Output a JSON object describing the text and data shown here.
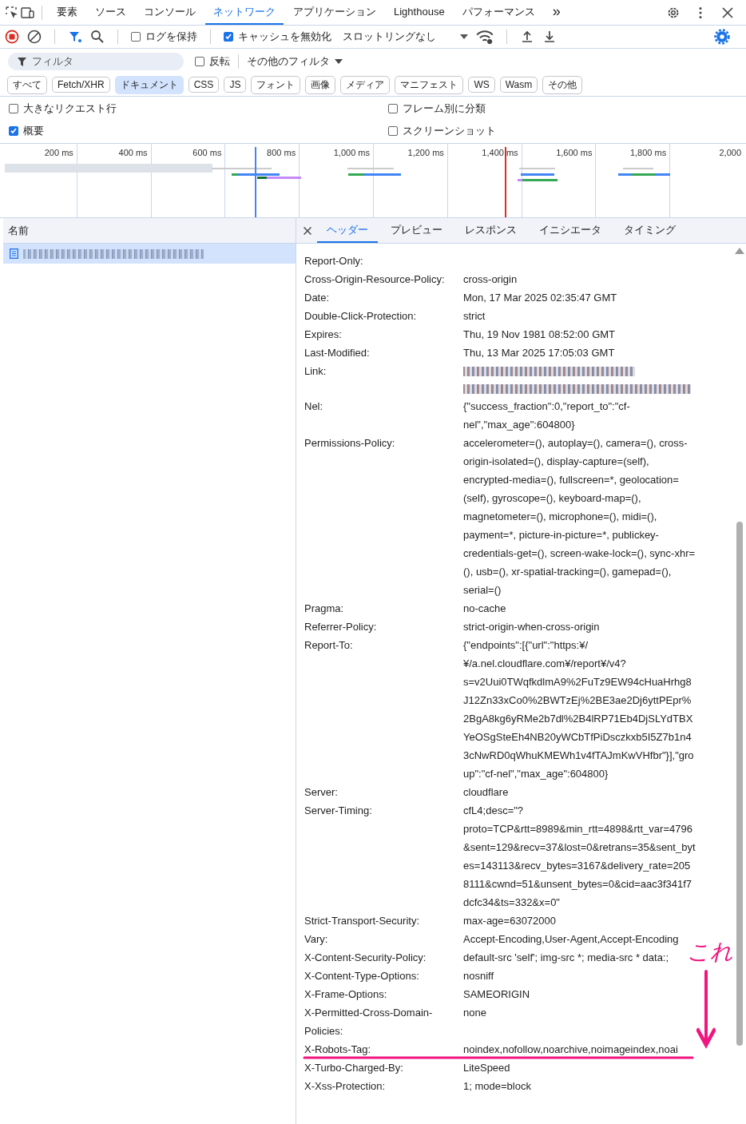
{
  "main_tabs": [
    {
      "label": "要素",
      "selected": false
    },
    {
      "label": "ソース",
      "selected": false
    },
    {
      "label": "コンソール",
      "selected": false
    },
    {
      "label": "ネットワーク",
      "selected": true
    },
    {
      "label": "アプリケーション",
      "selected": false
    },
    {
      "label": "Lighthouse",
      "selected": false
    },
    {
      "label": "パフォーマンス",
      "selected": false
    }
  ],
  "more_tabs": "»",
  "toolbar": {
    "preserve_log": {
      "label": "ログを保持",
      "checked": false
    },
    "disable_cache": {
      "label": "キャッシュを無効化",
      "checked": true
    },
    "throttling": "スロットリングなし"
  },
  "filter": {
    "placeholder": "フィルタ",
    "invert": {
      "label": "反転",
      "checked": false
    },
    "more_filters": "その他のフィルタ"
  },
  "type_filters": [
    {
      "label": "すべて",
      "selected": false
    },
    {
      "label": "Fetch/XHR",
      "selected": false
    },
    {
      "label": "ドキュメント",
      "selected": true
    },
    {
      "label": "CSS",
      "selected": false
    },
    {
      "label": "JS",
      "selected": false
    },
    {
      "label": "フォント",
      "selected": false
    },
    {
      "label": "画像",
      "selected": false
    },
    {
      "label": "メディア",
      "selected": false
    },
    {
      "label": "マニフェスト",
      "selected": false
    },
    {
      "label": "WS",
      "selected": false
    },
    {
      "label": "Wasm",
      "selected": false
    },
    {
      "label": "その他",
      "selected": false
    }
  ],
  "options": [
    {
      "label": "大きなリクエスト行",
      "checked": false
    },
    {
      "label": "フレーム別に分類",
      "checked": false
    },
    {
      "label": "概要",
      "checked": true
    },
    {
      "label": "スクリーンショット",
      "checked": false
    }
  ],
  "timeline": {
    "ticks": [
      "200 ms",
      "400 ms",
      "600 ms",
      "800 ms",
      "1,000 ms",
      "1,200 ms",
      "1,400 ms",
      "1,600 ms",
      "1,800 ms",
      "2,000"
    ]
  },
  "requests": {
    "column": "名前",
    "rows": [
      {
        "selected": true
      }
    ]
  },
  "detail_tabs": [
    {
      "label": "ヘッダー",
      "selected": true
    },
    {
      "label": "プレビュー",
      "selected": false
    },
    {
      "label": "レスポンス",
      "selected": false
    },
    {
      "label": "イニシエータ",
      "selected": false
    },
    {
      "label": "タイミング",
      "selected": false
    }
  ],
  "headers": [
    {
      "name": "Report-Only:"
    },
    {
      "name": "Cross-Origin-Resource-Policy:",
      "value": "cross-origin"
    },
    {
      "name": "Date:",
      "value": "Mon, 17 Mar 2025 02:35:47 GMT"
    },
    {
      "name": "Double-Click-Protection:",
      "value": "strict"
    },
    {
      "name": "Expires:",
      "value": "Thu, 19 Nov 1981 08:52:00 GMT"
    },
    {
      "name": "Last-Modified:",
      "value": "Thu, 13 Mar 2025 17:05:03 GMT"
    },
    {
      "name": "Link:",
      "redacted": true
    },
    {
      "name": "Nel:",
      "value": "{\"success_fraction\":0,\"report_to\":\"cf-nel\",\"max_age\":604800}"
    },
    {
      "name": "Permissions-Policy:",
      "value": "accelerometer=(), autoplay=(), camera=(), cross-origin-isolated=(), display-capture=(self), encrypted-media=(), fullscreen=*, geolocation=(self), gyroscope=(), keyboard-map=(), magnetometer=(), microphone=(), midi=(), payment=*, picture-in-picture=*, publickey-credentials-get=(), screen-wake-lock=(), sync-xhr=(), usb=(), xr-spatial-tracking=(), gamepad=(), serial=()"
    },
    {
      "name": "Pragma:",
      "value": "no-cache"
    },
    {
      "name": "Referrer-Policy:",
      "value": "strict-origin-when-cross-origin"
    },
    {
      "name": "Report-To:",
      "value": "{\"endpoints\":[{\"url\":\"https:¥/¥/a.nel.cloudflare.com¥/report¥/v4?s=v2Uui0TWqfkdlmA9%2FuTz9EW94cHuaHrhg8J12Zn33xCo0%2BWTzEj%2BE3ae2Dj6yttPEpr%2BgA8kg6yRMe2b7dl%2B4lRP71Eb4DjSLYdTBXYeOSgSteEh4NB20yWCbTfPiDsczkxb5I5Z7b1n43cNwRD0qWhuKMEWh1v4fTAJmKwVHfbr\"}],\"group\":\"cf-nel\",\"max_age\":604800}"
    },
    {
      "name": "Server:",
      "value": "cloudflare"
    },
    {
      "name": "Server-Timing:",
      "value": "cfL4;desc=\"?proto=TCP&rtt=8989&min_rtt=4898&rtt_var=4796&sent=129&recv=37&lost=0&retrans=35&sent_bytes=143113&recv_bytes=3167&delivery_rate=2058111&cwnd=51&unsent_bytes=0&cid=aac3f341f7dcfc34&ts=332&x=0\""
    },
    {
      "name": "Strict-Transport-Security:",
      "value": "max-age=63072000"
    },
    {
      "name": "Vary:",
      "value": "Accept-Encoding,User-Agent,Accept-Encoding"
    },
    {
      "name": "X-Content-Security-Policy:",
      "value": "default-src 'self'; img-src *; media-src * data:;"
    },
    {
      "name": "X-Content-Type-Options:",
      "value": "nosniff"
    },
    {
      "name": "X-Frame-Options:",
      "value": "SAMEORIGIN"
    },
    {
      "name": "X-Permitted-Cross-Domain-Policies:",
      "value": "none"
    },
    {
      "name": "X-Robots-Tag:",
      "value": "noindex,nofollow,noarchive,noimageindex,noai"
    },
    {
      "name": "X-Turbo-Charged-By:",
      "value": "LiteSpeed"
    },
    {
      "name": "X-Xss-Protection:",
      "value": "1; mode=block"
    }
  ],
  "annotation": {
    "text": "これ"
  }
}
